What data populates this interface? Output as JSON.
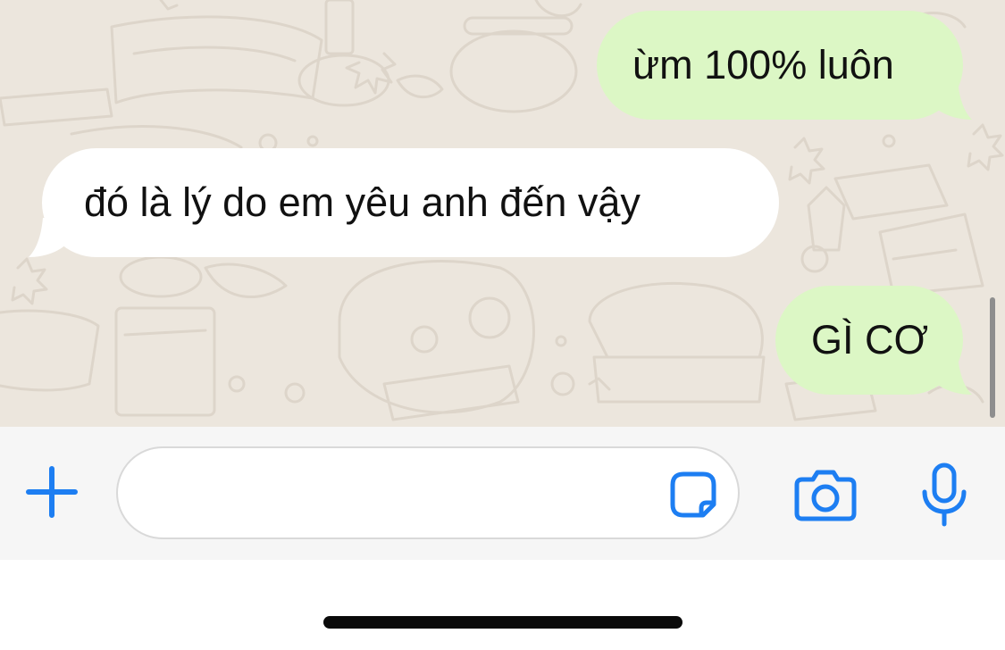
{
  "messages": [
    {
      "direction": "outgoing",
      "text": "ừm 100% luôn"
    },
    {
      "direction": "incoming",
      "text": "đó là lý do em yêu anh đến vậy"
    },
    {
      "direction": "outgoing",
      "text": "GÌ CƠ"
    }
  ],
  "composer": {
    "placeholder": "",
    "value": ""
  },
  "icons": {
    "attach": "plus-icon",
    "sticker": "sticker-icon",
    "camera": "camera-icon",
    "microphone": "microphone-icon"
  },
  "colors": {
    "chat_background": "#ece6dd",
    "outgoing_bubble": "#dcf7c5",
    "incoming_bubble": "#ffffff",
    "accent": "#1d7ef2",
    "input_bar": "#f6f6f6"
  }
}
